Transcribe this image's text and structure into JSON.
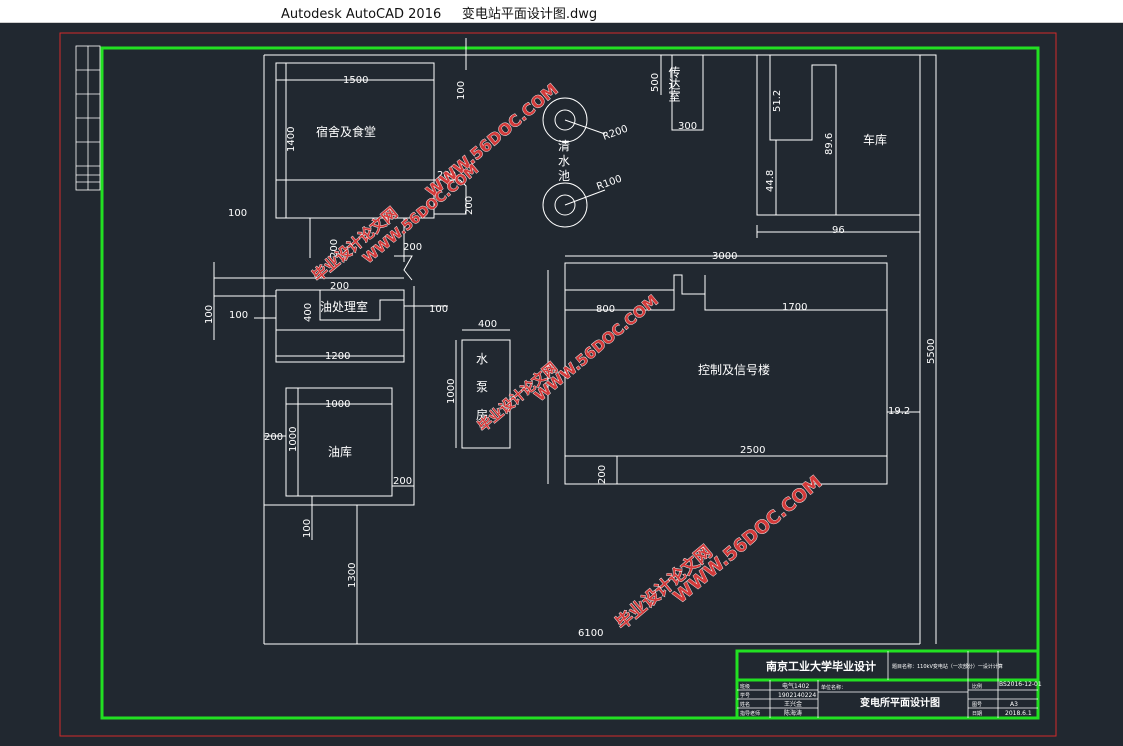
{
  "window": {
    "title": "Autodesk AutoCAD 2016     变电站平面设计图.dwg"
  },
  "rooms": {
    "dorm": "宿舍及食堂",
    "guard": "传达室",
    "garage": "车库",
    "oil_treat": "油处理室",
    "oil_store": "油库",
    "control": "控制及信号楼",
    "pump_1": "水",
    "pump_2": "泵",
    "pump_3": "房",
    "pool_1": "清",
    "pool_2": "水",
    "pool_3": "池"
  },
  "dims": {
    "d1500": "1500",
    "d1400": "1400",
    "d100_top": "100",
    "d500": "500",
    "d300": "300",
    "r200": "R200",
    "r100": "R100",
    "d51_2": "51.2",
    "d89_6": "89.6",
    "d44_8": "44.8",
    "d96": "96",
    "d200_a": "200",
    "d200_b": "200",
    "d200_c": "200",
    "d200_d": "200",
    "d200_e": "200",
    "d100_left": "100",
    "d100_oil_l": "100",
    "d100_oil_r": "100",
    "d100_vert": "100",
    "d400_oil": "400",
    "d1200": "1200",
    "d400_pump": "400",
    "d1000_pump": "1000",
    "d1000_w": "1000",
    "d1000_h": "1000",
    "d200_oilstore_l": "200",
    "d200_oilstore_r": "200",
    "d100_bottom": "100",
    "d1300": "1300",
    "d6100": "6100",
    "d5500": "5500",
    "d3000": "3000",
    "d800": "800",
    "d1700": "1700",
    "d2500": "2500",
    "d200_ctrl": "200",
    "d19_2": "19.2"
  },
  "title_block": {
    "school": "南京工业大学毕业设计",
    "subject": "题目名称：110kV变电站（一次部分）一设计计算",
    "drawing_no": "BS2016-12-01",
    "drawing_title": "变电所平面设计图",
    "r1_label": "班级",
    "r1_value": "电气1402",
    "r2_label": "学号",
    "r2_value": "1902140224",
    "r3_label": "姓名",
    "r3_value": "王兴金",
    "r4_label": "指导老师",
    "r4_value": "陈海涛",
    "unit_label": "单位名称：",
    "scale_label": "比例",
    "sheet_label": "图号",
    "sheet_value": "A3",
    "date_label": "日期",
    "date_value": "2018.6.1"
  },
  "watermarks": {
    "url": "WWW.56DOC.COM",
    "cn": "毕业设计论文网"
  },
  "colors": {
    "background": "#212830",
    "green_frame": "#22e022",
    "red_frame": "#d22a2a",
    "line": "#ffffff",
    "watermark": "#d33a3a"
  }
}
